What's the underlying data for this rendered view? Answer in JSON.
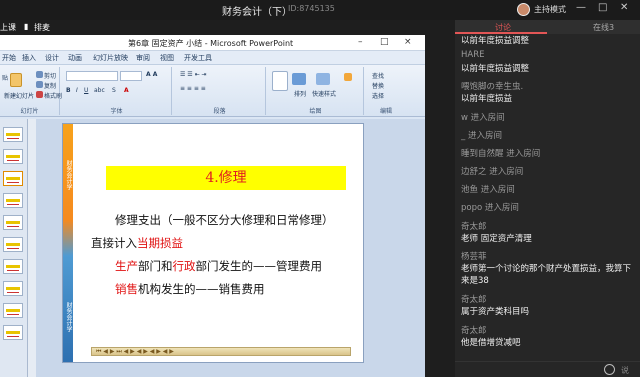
{
  "topbar": {
    "title": "财务会计（下）",
    "room_id": "ID:8745135",
    "mode": "主持模式",
    "minimize": "—",
    "maximize": "□",
    "close": "✕"
  },
  "left_tabs": {
    "tab1": "上课",
    "tab2": "排麦"
  },
  "ppt": {
    "window_title": "第6章 固定资产 小结 - Microsoft PowerPoint",
    "window_minimize": "–",
    "window_maximize": "□",
    "window_close": "×",
    "menu": [
      "开始",
      "插入",
      "设计",
      "动画",
      "幻灯片放映",
      "审阅",
      "视图",
      "开发工具"
    ],
    "ribbon_groups": {
      "clipboard_left": "贴",
      "cut": "剪切",
      "copy": "复制",
      "format": "格式刷",
      "new_slide": "新建幻灯片",
      "font_group": "字体",
      "paragraph_group": "段落",
      "drawing_group": "绘图",
      "edit_group": "编辑",
      "slides_group": "幻灯片",
      "find": "查找",
      "replace": "替换",
      "select": "选择",
      "arrange": "排列",
      "quick_styles": "快速样式"
    },
    "slide": {
      "heading": "4.修理",
      "line1": "修理支出（一般不区分大修理和日常修理）",
      "line2_a": "直接计入",
      "line2_b": "当期损益",
      "line3_a": "生产",
      "line3_b": "部门和",
      "line3_c": "行政",
      "line3_d": "部门发生的——管理费用",
      "line4_a": "销售",
      "line4_b": "机构发生的——销售费用",
      "sidebar_top": "财务会计学",
      "sidebar_bottom": "财务会计学"
    }
  },
  "panel": {
    "tab_discussion": "讨论",
    "tab_online": "在线3",
    "messages": [
      {
        "type": "text",
        "text": "以前年度损益调整"
      },
      {
        "type": "name",
        "text": "HARE"
      },
      {
        "type": "text",
        "text": "以前年度损益调整"
      },
      {
        "type": "name",
        "text": "喂饱脚の幸生虫."
      },
      {
        "type": "text",
        "text": "以前年度损益"
      },
      {
        "type": "sys",
        "text": "w 进入房间"
      },
      {
        "type": "sys",
        "text": "_ 进入房间"
      },
      {
        "type": "sys",
        "text": "睡到自然醒 进入房间"
      },
      {
        "type": "sys",
        "text": "边舒之 进入房间"
      },
      {
        "type": "sys",
        "text": "池鱼 进入房间"
      },
      {
        "type": "sys",
        "text": "popo 进入房间"
      },
      {
        "type": "name",
        "text": "奇太郎"
      },
      {
        "type": "text",
        "text": "老师  固定资产清理"
      },
      {
        "type": "name",
        "text": "杨芸菲"
      },
      {
        "type": "text",
        "text": "老师第一个讨论的那个财产处置损益，我算下"
      },
      {
        "type": "text",
        "text": "来是38"
      },
      {
        "type": "name",
        "text": "奇太郎"
      },
      {
        "type": "text",
        "text": "属于资产类科目吗"
      },
      {
        "type": "name",
        "text": "奇太郎"
      },
      {
        "type": "text",
        "text": "他是借增贷减吧"
      }
    ],
    "input_placeholder": "说"
  }
}
